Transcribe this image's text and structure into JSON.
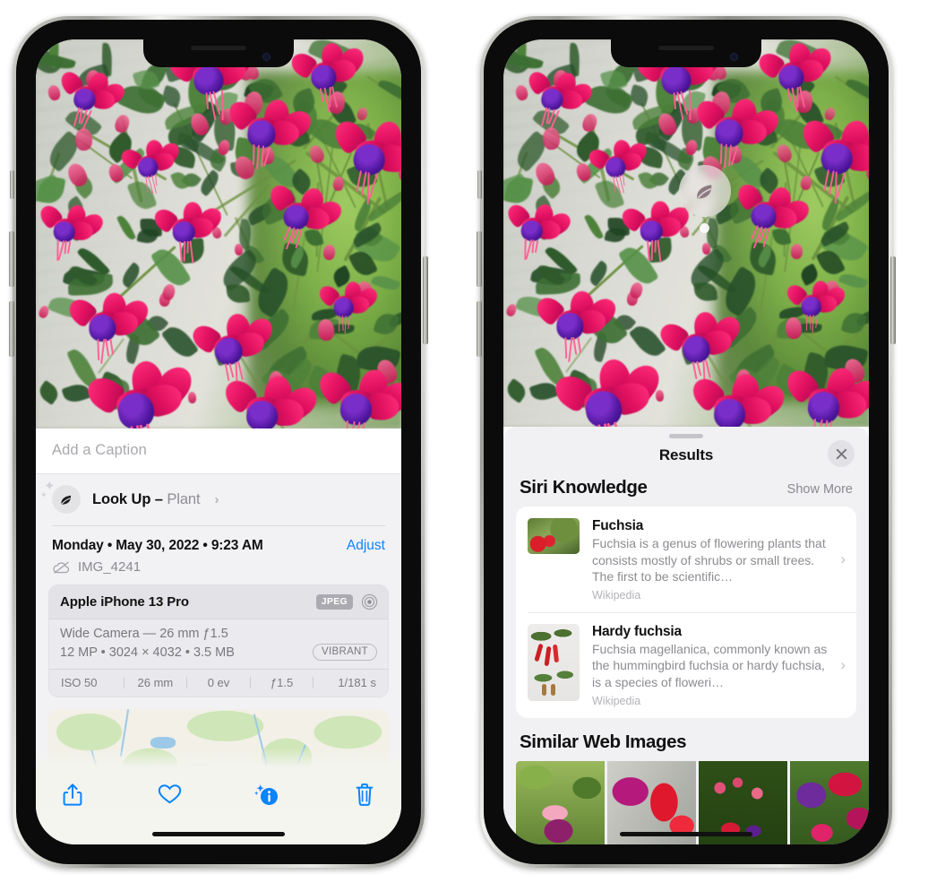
{
  "left_phone": {
    "name": "photo-detail-screen",
    "caption": {
      "placeholder": "Add a Caption",
      "value": ""
    },
    "look_up": {
      "label": "Look Up – ",
      "subject": "Plant",
      "chevron": "›",
      "icon": "leaf-icon"
    },
    "meta": {
      "date": "Monday • May 30, 2022 • 9:23 AM",
      "adjust_label": "Adjust",
      "file_name": "IMG_4241",
      "cloud_icon": "cloud-slash-icon"
    },
    "camera_card": {
      "model": "Apple iPhone 13 Pro",
      "format_badge": "JPEG",
      "hdr_icon": "aperture-icon",
      "lens_line": "Wide Camera — 26 mm ƒ1.5",
      "size_line": "12 MP • 3024 × 4032 • 3.5 MB",
      "style_badge": "VIBRANT",
      "exif": [
        "ISO 50",
        "26 mm",
        "0 ev",
        "ƒ1.5",
        "1/181 s"
      ]
    },
    "toolbar": [
      {
        "name": "share-icon",
        "label": "Share"
      },
      {
        "name": "heart-icon",
        "label": "Favorite"
      },
      {
        "name": "info-sparkle-icon",
        "label": "Info"
      },
      {
        "name": "trash-icon",
        "label": "Delete"
      }
    ]
  },
  "right_phone": {
    "name": "visual-lookup-results-screen",
    "photo_badge": {
      "icon": "leaf-icon",
      "label": "Plant indicator"
    },
    "sheet": {
      "title": "Results",
      "close_icon": "close-icon",
      "siri_knowledge": {
        "heading": "Siri Knowledge",
        "show_more": "Show More",
        "items": [
          {
            "title": "Fuchsia",
            "description": "Fuchsia is a genus of flowering plants that consists mostly of shrubs or small trees. The first to be scientific…",
            "source": "Wikipedia",
            "thumb": "fuchsia-red-flowers-thumbnail"
          },
          {
            "title": "Hardy fuchsia",
            "description": "Fuchsia magellanica, commonly known as the hummingbird fuchsia or hardy fuchsia, is a species of floweri…",
            "source": "Wikipedia",
            "thumb": "hardy-fuchsia-branch-thumbnail"
          }
        ]
      },
      "similar_web_images": {
        "heading": "Similar Web Images",
        "tiles": [
          "fuchsia-pink-white-bloom",
          "fuchsia-red-closeup",
          "fuchsia-bush-buds",
          "fuchsia-purple-magenta"
        ]
      }
    }
  },
  "colors": {
    "accent_blue": "#0a84ff",
    "panel_bg": "#f2f2f5",
    "card_bg": "#ffffff",
    "secondary_text": "#8e8e93",
    "badge_gray": "#aaaab0"
  }
}
